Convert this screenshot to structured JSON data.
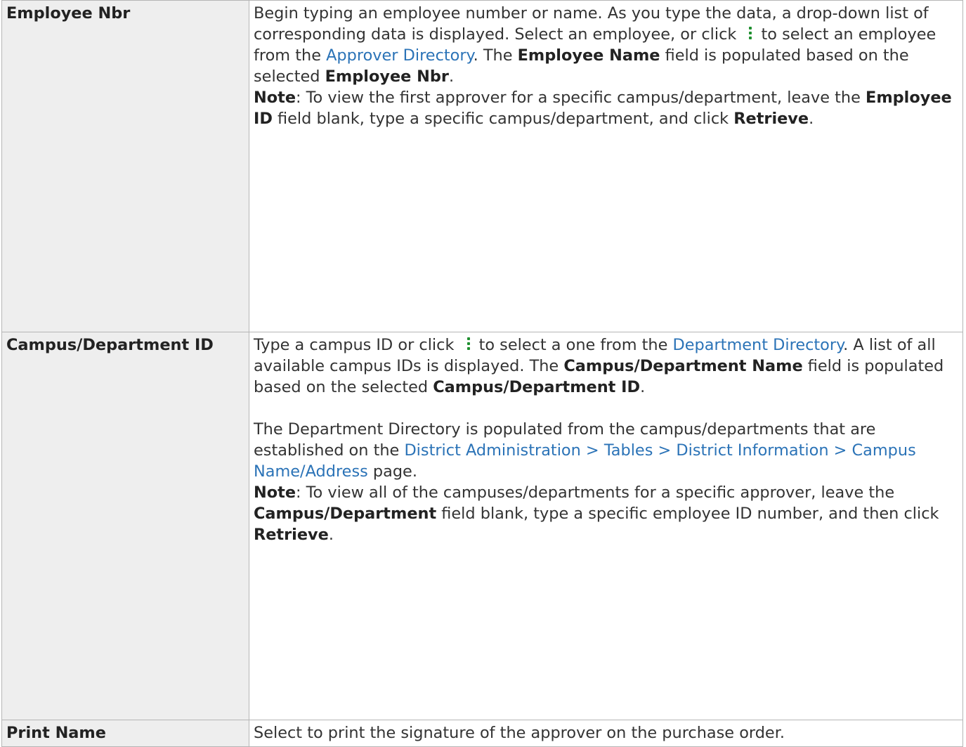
{
  "rows": [
    {
      "label": "Employee Nbr",
      "parts": {
        "t1": "Begin typing an employee number or name. As you type the data, a drop-down list of corresponding data is displayed. Select an employee, or click",
        "t2": "to select an employee from the",
        "link": "Approver Directory",
        "t3": ". The",
        "b1": "Employee Name",
        "t4": "field is populated based on the selected",
        "b2": "Employee Nbr",
        "t5": ".",
        "note_label": "Note",
        "n1": ": To view the first approver for a specific campus/department, leave the",
        "nb1": "Employee ID",
        "n2": "field blank, type a specific campus/department, and click",
        "nb2": "Retrieve",
        "n3": "."
      }
    },
    {
      "label": "Campus/Department ID",
      "parts": {
        "t1": "Type a campus ID or click",
        "t2": "to select a one from the",
        "link": "Department Directory",
        "t3": ". A list of all available campus IDs is displayed. The",
        "b1": "Campus/Department Name",
        "t4": "field is populated based on the selected",
        "b2": "Campus/Department ID",
        "t5": ".",
        "p2a": "The Department Directory is populated from the campus/departments that are established on the",
        "p2link": "District Administration > Tables > District Information > Campus Name/Address",
        "p2b": "page.",
        "note_label": "Note",
        "n1": ": To view all of the campuses/departments for a specific approver, leave the",
        "nb1": "Campus/Department",
        "n2": "field blank, type a specific employee ID number, and then click",
        "nb2": "Retrieve",
        "n3": "."
      }
    },
    {
      "label": "Print Name",
      "text": "Select to print the signature of the approver on the purchase order."
    }
  ],
  "icons": {
    "lookup": "vertical-ellipsis-lookup-icon",
    "color": "#1f8f2f"
  },
  "colors": {
    "link": "#2b73b7",
    "label_bg": "#eeeeee",
    "border": "#b5b5b5"
  }
}
